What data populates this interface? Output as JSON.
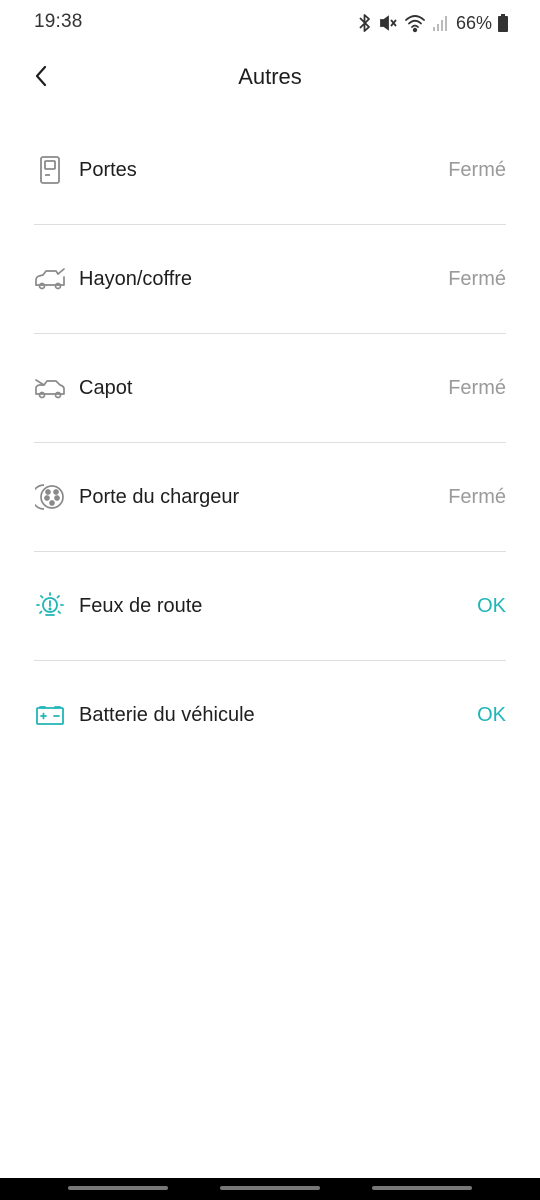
{
  "status_bar": {
    "time": "19:38",
    "battery_percent": "66%",
    "icons": [
      "bluetooth-icon",
      "mute-vibrate-icon",
      "wifi-icon",
      "signal-icon",
      "battery-icon"
    ]
  },
  "header": {
    "title": "Autres",
    "back_icon": "chevron-left-icon"
  },
  "items": [
    {
      "icon": "door-icon",
      "label": "Portes",
      "value": "Fermé",
      "status": "neutral"
    },
    {
      "icon": "car-trunk-icon",
      "label": "Hayon/coffre",
      "value": "Fermé",
      "status": "neutral"
    },
    {
      "icon": "car-hood-icon",
      "label": "Capot",
      "value": "Fermé",
      "status": "neutral"
    },
    {
      "icon": "charge-port-icon",
      "label": "Porte du chargeur",
      "value": "Fermé",
      "status": "neutral"
    },
    {
      "icon": "headlight-warning-icon",
      "label": "Feux de route",
      "value": "OK",
      "status": "ok"
    },
    {
      "icon": "car-battery-icon",
      "label": "Batterie du véhicule",
      "value": "OK",
      "status": "ok"
    }
  ],
  "colors": {
    "ok": "#20b5b8",
    "neutral_value": "#9a9a9a",
    "icon_gray": "#8a8a8a",
    "divider": "#dedede"
  }
}
